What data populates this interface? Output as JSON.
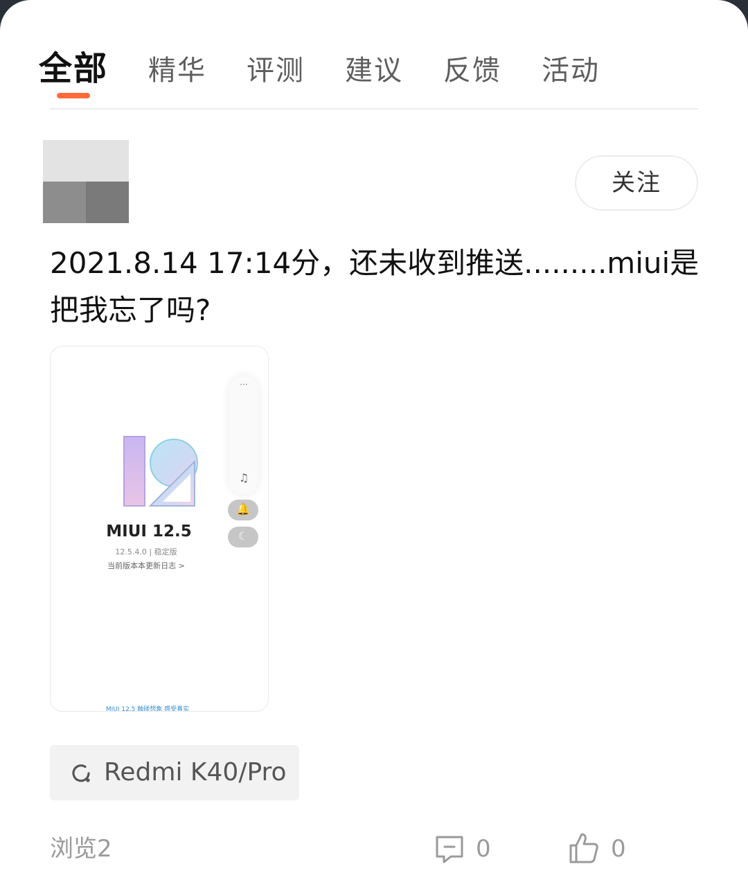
{
  "tabs": [
    {
      "label": "全部",
      "active": true
    },
    {
      "label": "精华",
      "active": false
    },
    {
      "label": "评测",
      "active": false
    },
    {
      "label": "建议",
      "active": false
    },
    {
      "label": "反馈",
      "active": false
    },
    {
      "label": "活动",
      "active": false
    }
  ],
  "author": {
    "follow_label": "关注"
  },
  "post": {
    "text": "2021.8.14 17:14分，还未收到推送.........miui是把我忘了吗?",
    "image": {
      "title": "MIUI 12.5",
      "version": "12.5.4.0 | 稳定版",
      "changelog": "当前版本本更新日志 >",
      "panel_dots": "···",
      "panel_note": "♫",
      "bell_glyph": "🔔",
      "moon_glyph": "☾",
      "bottom_text": "MIUI 12.5 触碰想象 感受真实"
    },
    "device_tag": {
      "icon": "refresh-circle-icon",
      "label": "Redmi K40/Pro"
    }
  },
  "footer": {
    "views": "浏览2",
    "comments": {
      "icon": "comment-icon",
      "count": "0"
    },
    "likes": {
      "icon": "thumbs-up-icon",
      "count": "0"
    }
  },
  "colors": {
    "accent": "#ff6a3a",
    "muted": "#9a9a9a",
    "tag_bg": "#f2f2f2"
  }
}
